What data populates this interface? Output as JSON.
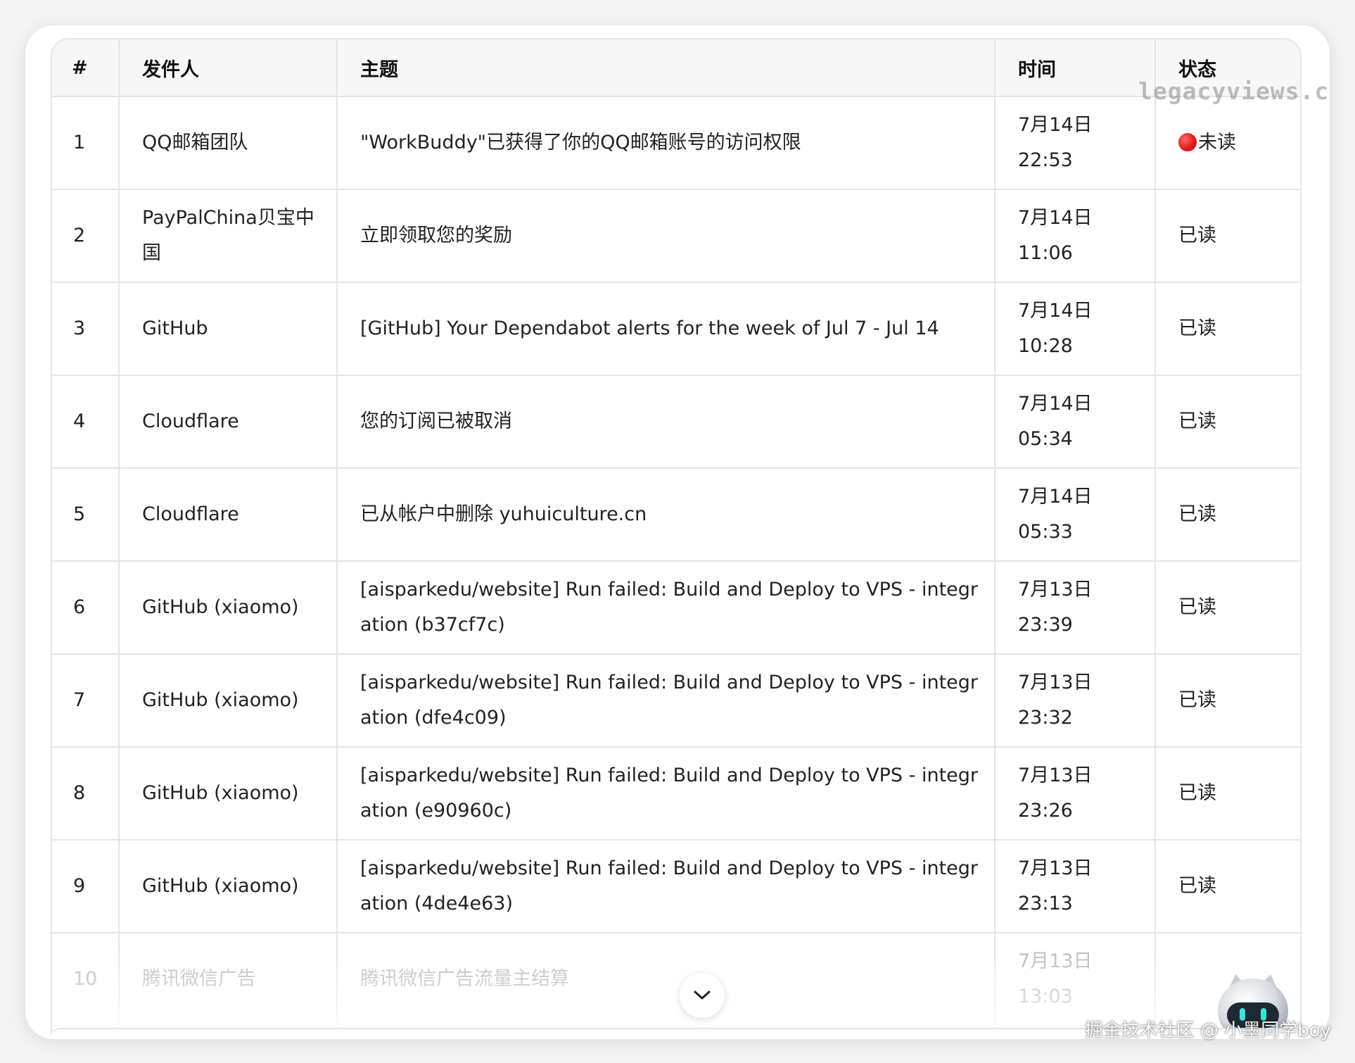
{
  "table": {
    "headers": [
      "#",
      "发件人",
      "主题",
      "时间",
      "状态"
    ],
    "rows": [
      {
        "num": "1",
        "sender": "QQ邮箱团队",
        "subject": "\"WorkBuddy\"已获得了你的QQ邮箱账号的访问权限",
        "date": "7月14日",
        "time": "22:53",
        "status": "未读",
        "unread": true
      },
      {
        "num": "2",
        "sender": "PayPalChina贝宝中国",
        "subject": "立即领取您的奖励",
        "date": "7月14日",
        "time": "11:06",
        "status": "已读",
        "unread": false
      },
      {
        "num": "3",
        "sender": "GitHub",
        "subject": "[GitHub] Your Dependabot alerts for the week of Jul 7 - Jul 14",
        "date": "7月14日",
        "time": "10:28",
        "status": "已读",
        "unread": false
      },
      {
        "num": "4",
        "sender": "Cloudflare",
        "subject": "您的订阅已被取消",
        "date": "7月14日",
        "time": "05:34",
        "status": "已读",
        "unread": false
      },
      {
        "num": "5",
        "sender": "Cloudflare",
        "subject": "已从帐户中删除 yuhuiculture.cn",
        "date": "7月14日",
        "time": "05:33",
        "status": "已读",
        "unread": false
      },
      {
        "num": "6",
        "sender": "GitHub (xiaomo)",
        "subject": "[aisparkedu/website] Run failed: Build and Deploy to VPS - integration (b37cf7c)",
        "date": "7月13日",
        "time": "23:39",
        "status": "已读",
        "unread": false
      },
      {
        "num": "7",
        "sender": "GitHub (xiaomo)",
        "subject": "[aisparkedu/website] Run failed: Build and Deploy to VPS - integration (dfe4c09)",
        "date": "7月13日",
        "time": "23:32",
        "status": "已读",
        "unread": false
      },
      {
        "num": "8",
        "sender": "GitHub (xiaomo)",
        "subject": "[aisparkedu/website] Run failed: Build and Deploy to VPS - integration (e90960c)",
        "date": "7月13日",
        "time": "23:26",
        "status": "已读",
        "unread": false
      },
      {
        "num": "9",
        "sender": "GitHub (xiaomo)",
        "subject": "[aisparkedu/website] Run failed: Build and Deploy to VPS - integration (4de4e63)",
        "date": "7月13日",
        "time": "23:13",
        "status": "已读",
        "unread": false
      },
      {
        "num": "10",
        "sender": "腾讯微信广告",
        "subject": "腾讯微信广告流量主结算",
        "date": "7月13日",
        "time": "13:03",
        "status": "",
        "unread": false
      }
    ]
  },
  "watermark_top": "legacyviews.com",
  "watermark_bottom": "掘金技术社区 @ 小墨同学boy",
  "icons": {
    "scroll": "chevron-down-icon",
    "status_unread": "red-circle-icon",
    "mascot": "robot-mascot-icon"
  },
  "colors": {
    "unread_dot": "#e21b1b",
    "header_bg": "#f7f7f7",
    "border": "#e4e4e4"
  }
}
